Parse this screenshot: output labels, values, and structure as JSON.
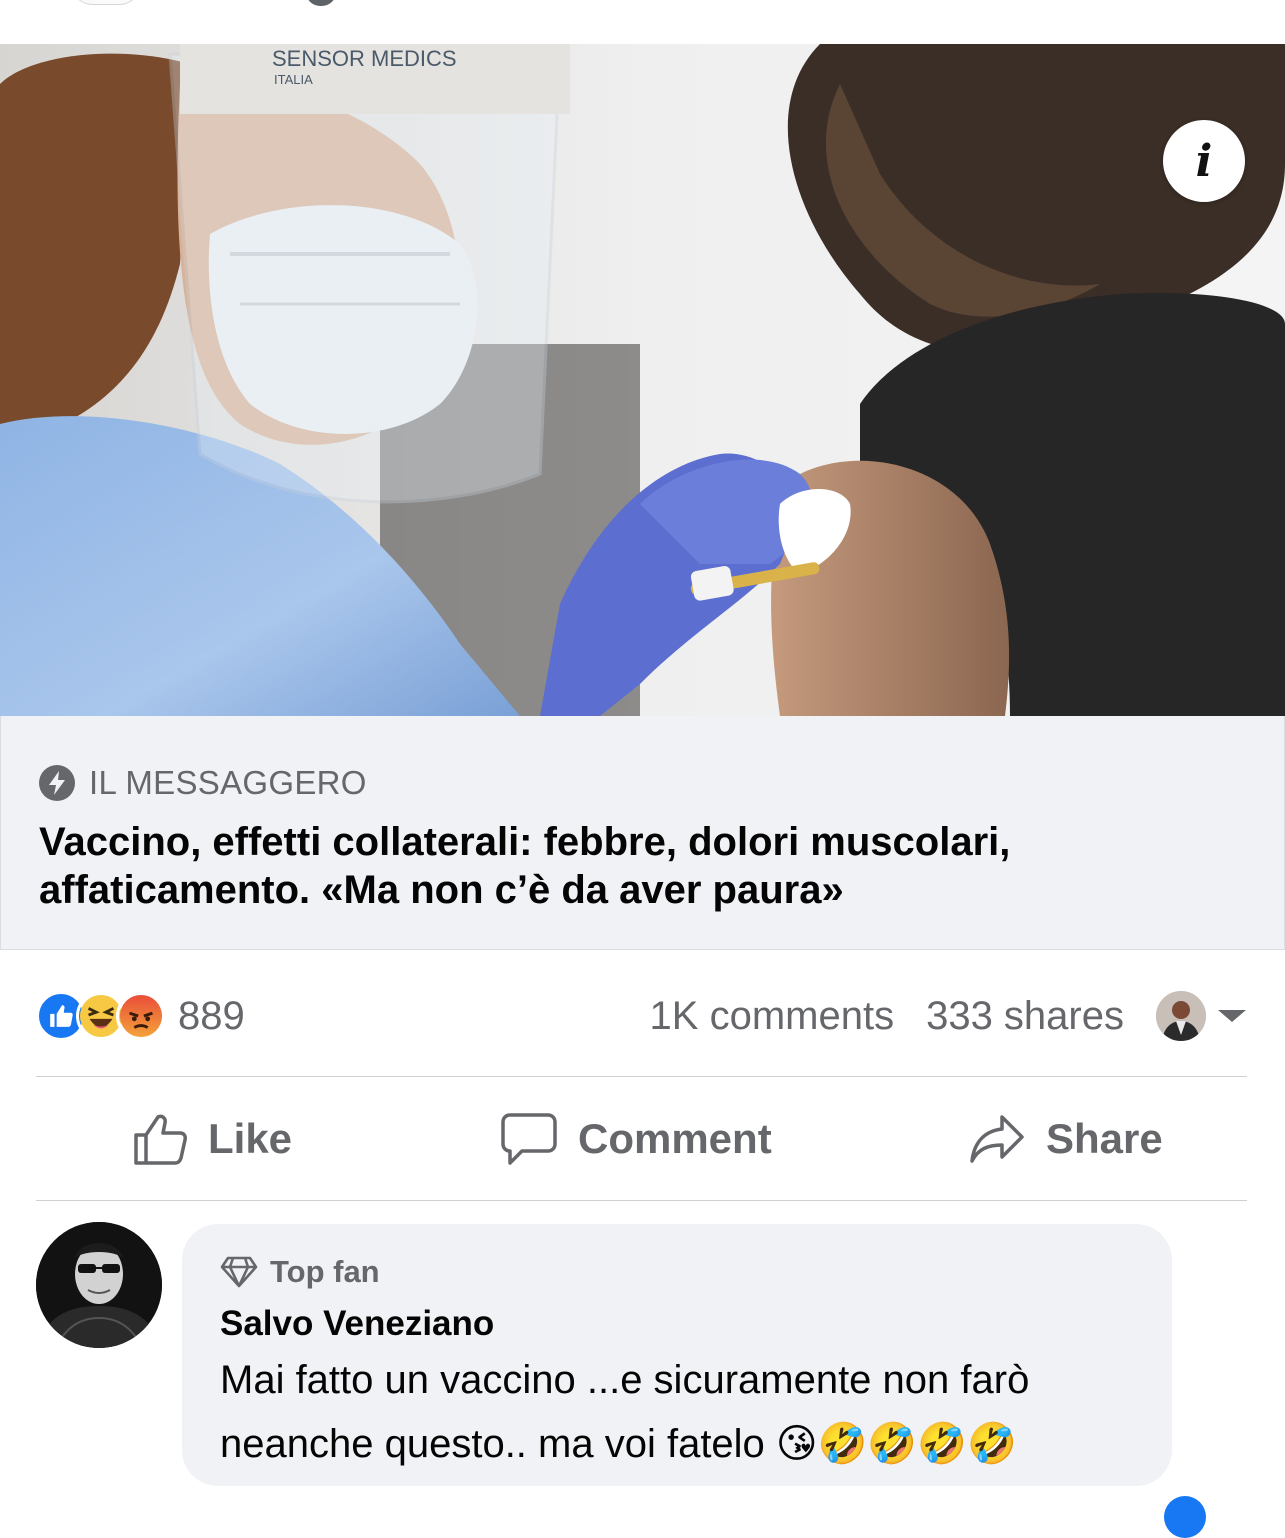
{
  "photo": {
    "shield_brand": "SENSOR MEDICS",
    "shield_sub": "ITALIA"
  },
  "link_preview": {
    "source": "IL MESSAGGERO",
    "headline": "Vaccino, effetti collaterali: febbre, dolori muscolari, affaticamento. «Ma non c’è da aver paura»"
  },
  "reactions": {
    "icons": [
      "like-icon",
      "haha-icon",
      "angry-icon"
    ],
    "count": "889"
  },
  "stats": {
    "comments": "1K comments",
    "shares": "333 shares"
  },
  "actions": {
    "like": "Like",
    "comment": "Comment",
    "share": "Share"
  },
  "comment": {
    "badge": "Top fan",
    "author": "Salvo Veneziano",
    "text": "Mai fatto un vaccino ...e sicuramente non farò neanche questo.. ma voi fatelo 😘🤣🤣🤣🤣"
  },
  "colors": {
    "brand_blue": "#1877f2",
    "secondary_text": "#65676b",
    "card_bg": "#f0f2f5"
  }
}
